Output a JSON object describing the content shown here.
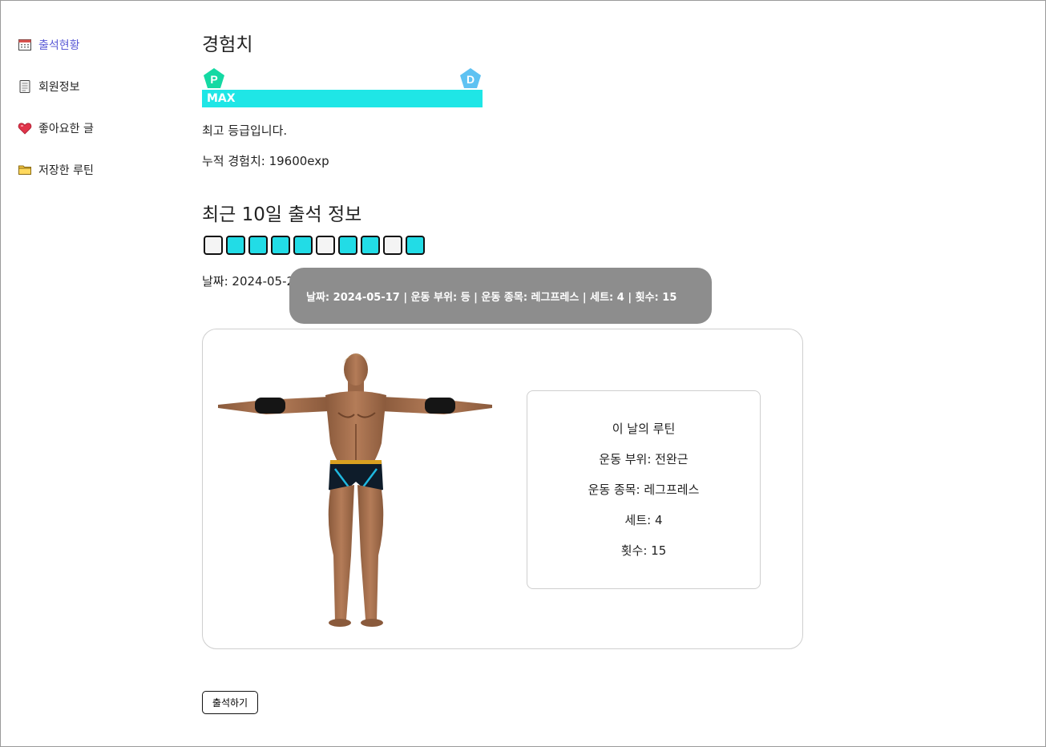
{
  "sidebar": {
    "items": [
      {
        "label": "출석현황",
        "icon": "calendar-icon",
        "active": true
      },
      {
        "label": "회원정보",
        "icon": "document-icon",
        "active": false
      },
      {
        "label": "좋아요한 글",
        "icon": "heart-icon",
        "active": false
      },
      {
        "label": "저장한 루틴",
        "icon": "folder-icon",
        "active": false
      }
    ]
  },
  "experience": {
    "title": "경험치",
    "current_grade": "P",
    "next_grade": "D",
    "bar_label": "MAX",
    "bar_progress": 1.0,
    "bar_color": "#1fe6e6",
    "status_text": "최고 등급입니다.",
    "total_text": "누적 경험치: 19600exp"
  },
  "attendance": {
    "title": "최근 10일 출석 정보",
    "days": [
      false,
      true,
      true,
      true,
      true,
      false,
      true,
      true,
      false,
      true
    ],
    "on_color": "#22dce6",
    "date_text": "날짜: 2024-05-21"
  },
  "tooltip": {
    "text": "날짜: 2024-05-17 |  운동 부위: 등 |  운동 종목: 레그프레스 |  세트: 4 |  횟수: 15"
  },
  "routine": {
    "heading": "이 날의 루틴",
    "part": "운동 부위: 전완근",
    "exercise": "운동 종목: 레그프레스",
    "sets": "세트: 4",
    "reps": "횟수: 15"
  },
  "actions": {
    "attend_label": "출석하기"
  }
}
